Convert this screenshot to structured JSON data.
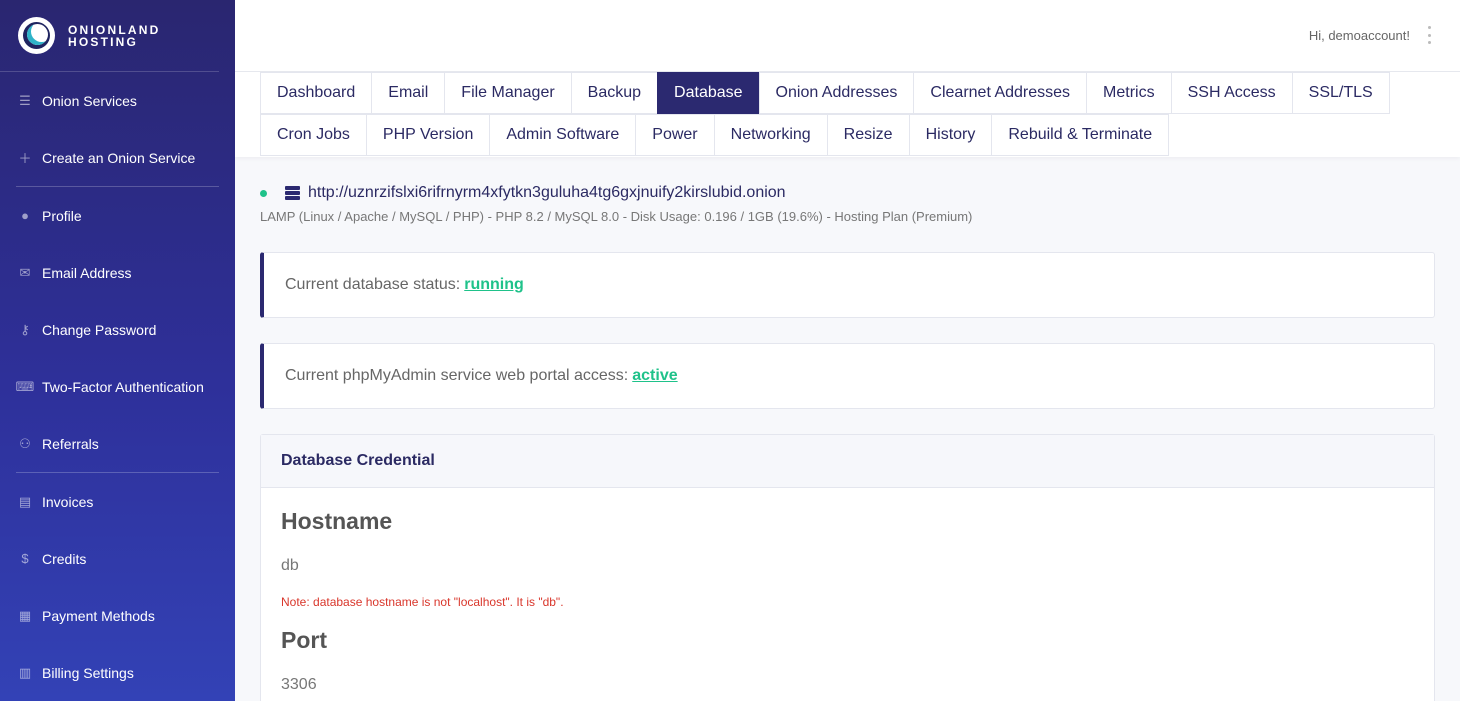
{
  "brand": {
    "line1": "ONIONLAND",
    "line2": "HOSTING"
  },
  "sidebar": {
    "items": [
      {
        "label": "Onion Services",
        "icon": "list-icon"
      },
      {
        "label": "Create an Onion Service",
        "icon": "plus-icon"
      },
      {
        "label": "Profile",
        "icon": "user-icon"
      },
      {
        "label": "Email Address",
        "icon": "mail-icon"
      },
      {
        "label": "Change Password",
        "icon": "key-icon"
      },
      {
        "label": "Two-Factor Authentication",
        "icon": "keyboard-icon"
      },
      {
        "label": "Referrals",
        "icon": "users-icon"
      },
      {
        "label": "Invoices",
        "icon": "file-icon"
      },
      {
        "label": "Credits",
        "icon": "dollar-icon"
      },
      {
        "label": "Payment Methods",
        "icon": "money-icon"
      },
      {
        "label": "Billing Settings",
        "icon": "file-settings-icon"
      }
    ]
  },
  "header": {
    "greeting": "Hi, demoaccount!"
  },
  "tabs": {
    "row1": [
      "Dashboard",
      "Email",
      "File Manager",
      "Backup",
      "Database",
      "Onion Addresses",
      "Clearnet Addresses",
      "Metrics",
      "SSH Access",
      "SSL/TLS"
    ],
    "row2": [
      "Cron Jobs",
      "PHP Version",
      "Admin Software",
      "Power",
      "Networking",
      "Resize",
      "History",
      "Rebuild & Terminate"
    ],
    "active": "Database"
  },
  "service": {
    "url": "http://uznrzifslxi6rifrnyrm4xfytkn3guluha4tg6gxjnuify2kirslubid.onion",
    "meta": "LAMP (Linux / Apache / MySQL / PHP) - PHP 8.2 / MySQL 8.0 - Disk Usage: 0.196 / 1GB (19.6%) - Hosting Plan (Premium)"
  },
  "status": {
    "db_label": "Current database status:",
    "db_value": "running",
    "pma_label": "Current phpMyAdmin service web portal access:",
    "pma_value": "active"
  },
  "credential": {
    "title": "Database Credential",
    "hostname_label": "Hostname",
    "hostname_value": "db",
    "hostname_note": "Note: database hostname is not \"localhost\". It is \"db\".",
    "port_label": "Port",
    "port_value": "3306"
  },
  "colors": {
    "primary": "#2b2970",
    "success": "#1fc28a",
    "danger": "#d9362b"
  }
}
